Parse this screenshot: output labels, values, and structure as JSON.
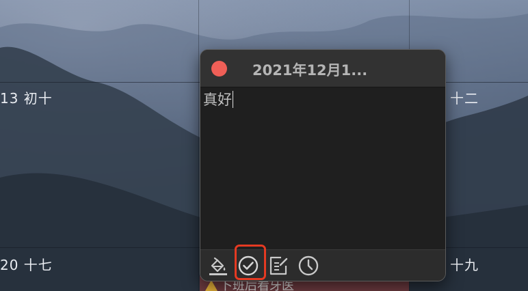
{
  "calendar": {
    "cells": [
      {
        "label": "13  初十"
      },
      {
        "label": "十二"
      },
      {
        "label": "20  十七"
      },
      {
        "label": "十九"
      }
    ],
    "event": {
      "text": "卜班后看牙医"
    }
  },
  "popup": {
    "title": "2021年12月1...",
    "note_text": "真好",
    "toolbar": {
      "items": [
        {
          "icon": "fill-color-icon"
        },
        {
          "icon": "checkmark-circle-icon"
        },
        {
          "icon": "edit-note-icon"
        },
        {
          "icon": "clock-icon"
        }
      ]
    },
    "close_color": "#ef5f57",
    "highlight_color": "#e53a22"
  }
}
